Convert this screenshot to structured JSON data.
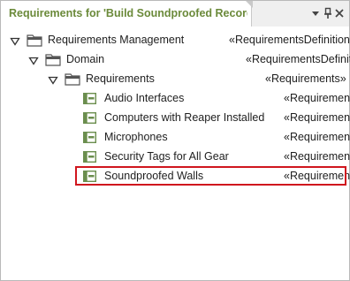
{
  "panel": {
    "title": "Requirements for 'Build Soundproofed Recordi..."
  },
  "tree": {
    "nodes": [
      {
        "label": "Requirements Management",
        "stereotype": "«RequirementsDefinition»"
      },
      {
        "label": "Domain",
        "stereotype": "«RequirementsDefinit"
      },
      {
        "label": "Requirements",
        "stereotype": "«Requirements»"
      },
      {
        "label": "Audio Interfaces",
        "stereotype": "«Requirement"
      },
      {
        "label": "Computers with Reaper Installed",
        "stereotype": "«Requirement"
      },
      {
        "label": "Microphones",
        "stereotype": "«Requirement"
      },
      {
        "label": "Security Tags for All Gear",
        "stereotype": "«Requirement"
      },
      {
        "label": "Soundproofed Walls",
        "stereotype": "«Requirement"
      }
    ],
    "selected_index": 7
  },
  "icons": {
    "folder": "folder-icon",
    "requirement": "requirement-icon",
    "expander": "expanded-triangle-icon",
    "dropdown": "dropdown-icon",
    "pin": "pin-icon",
    "close": "close-icon"
  },
  "colors": {
    "title": "#6b8a3a",
    "requirement_icon": "#6b8e4e",
    "highlight": "#d0161e"
  }
}
